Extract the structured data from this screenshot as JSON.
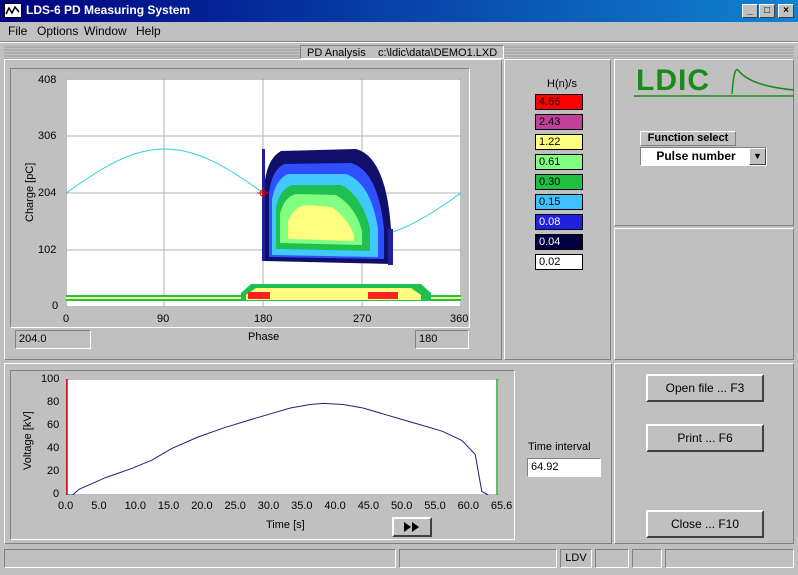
{
  "window": {
    "title": "LDS-6  PD Measuring System"
  },
  "menu": {
    "file": "File",
    "options": "Options",
    "window": "Window",
    "help": "Help"
  },
  "header": {
    "analysis_label": "PD Analysis",
    "file_path": "c:\\ldic\\data\\DEMO1.LXD"
  },
  "pd_plot": {
    "ylabel": "Charge [pC]",
    "xlabel": "Phase",
    "y_ticks": [
      "408",
      "306",
      "204",
      "102",
      "0"
    ],
    "x_ticks": [
      "0",
      "90",
      "180",
      "270",
      "360"
    ],
    "cursor_value": "204.0",
    "cursor_phase": "180"
  },
  "legend": {
    "title": "H(n)/s",
    "entries": [
      {
        "value": "4.66",
        "color": "#ff0000"
      },
      {
        "value": "2.43",
        "color": "#c0409a"
      },
      {
        "value": "1.22",
        "color": "#ffff80"
      },
      {
        "value": "0.61",
        "color": "#80ff80"
      },
      {
        "value": "0.30",
        "color": "#20c040"
      },
      {
        "value": "0.15",
        "color": "#40c0ff"
      },
      {
        "value": "0.08",
        "color": "#2020e0"
      },
      {
        "value": "0.04",
        "color": "#000040"
      },
      {
        "value": "0.02",
        "color": "#ffffff"
      }
    ]
  },
  "logo": {
    "text": "LDIC"
  },
  "function_select": {
    "label": "Function select",
    "value": "Pulse number"
  },
  "voltage_plot": {
    "ylabel": "Voltage [kV]",
    "xlabel": "Time [s]",
    "y_ticks": [
      "100",
      "80",
      "60",
      "40",
      "20",
      "0"
    ],
    "x_ticks": [
      "0.0",
      "5.0",
      "10.0",
      "15.0",
      "20.0",
      "25.0",
      "30.0",
      "35.0",
      "40.0",
      "45.0",
      "50.0",
      "55.0",
      "60.0",
      "65.6"
    ]
  },
  "time_interval": {
    "label": "Time interval",
    "value": "64.92"
  },
  "buttons": {
    "open": "Open file ... F3",
    "print": "Print ... F6",
    "close": "Close ... F10"
  },
  "status": {
    "ldv": "LDV"
  },
  "chart_data": {
    "type": "line",
    "xlabel": "Time [s]",
    "ylabel": "Voltage [kV]",
    "xlim": [
      0,
      65.6
    ],
    "ylim": [
      0,
      100
    ],
    "x": [
      0,
      1,
      2,
      4,
      6,
      8,
      10,
      13,
      16,
      20,
      24,
      28,
      31,
      34,
      37,
      39,
      42,
      45,
      48,
      51,
      54,
      57,
      60,
      62,
      63,
      64
    ],
    "y": [
      0,
      0,
      5,
      10,
      15,
      19,
      23,
      30,
      40,
      50,
      58,
      65,
      70,
      75,
      78,
      79,
      78,
      75,
      70,
      65,
      60,
      55,
      47,
      35,
      3,
      0
    ],
    "grid": true
  }
}
